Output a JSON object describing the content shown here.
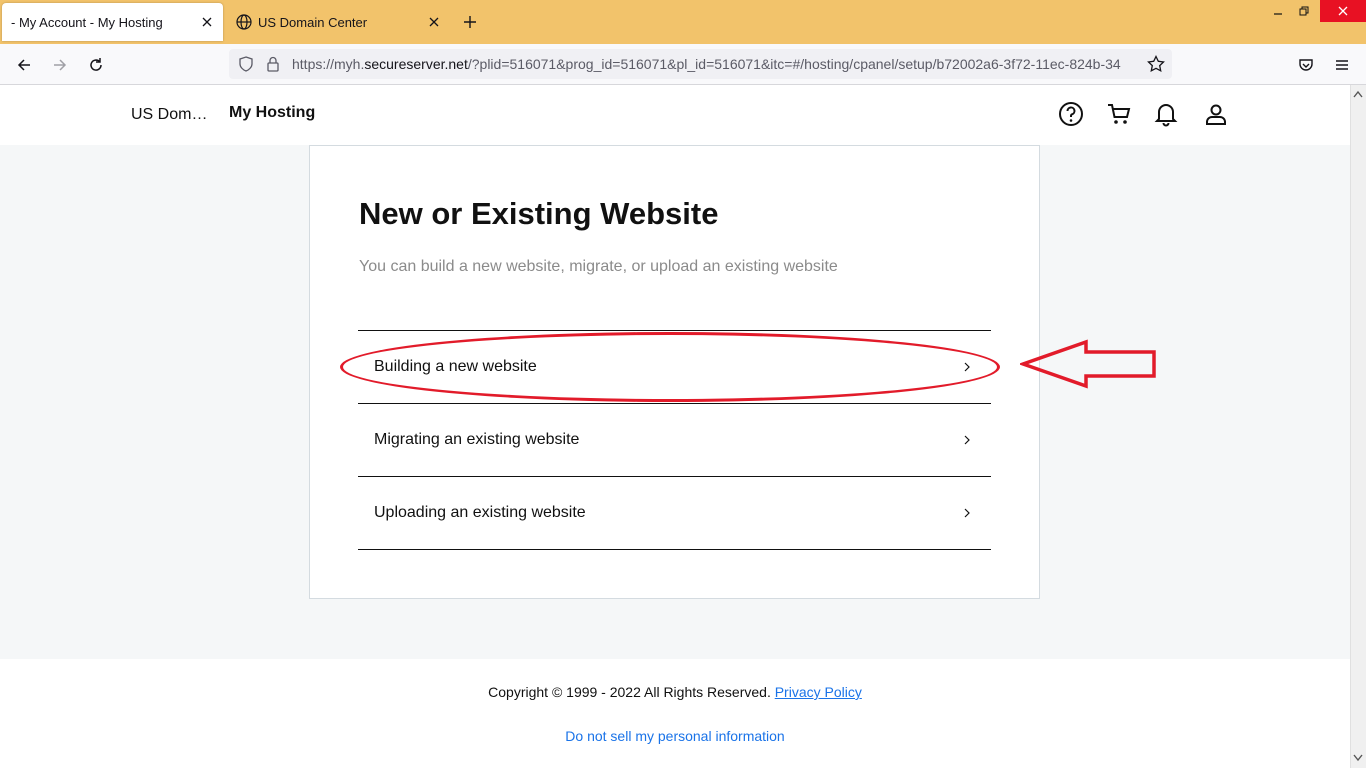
{
  "browser": {
    "tabs": [
      {
        "label": "- My Account - My Hosting",
        "active": true
      },
      {
        "label": "US Domain Center",
        "active": false
      }
    ],
    "url_prefix": "https://myh.",
    "url_domain": "secureserver.net",
    "url_rest": "/?plid=516071&prog_id=516071&pl_id=516071&itc=#/hosting/cpanel/setup/b72002a6-3f72-11ec-824b-34"
  },
  "header": {
    "brand": "US Domain Center",
    "nav_label": "My Hosting"
  },
  "card": {
    "title": "New or Existing Website",
    "subtitle": "You can build a new website, migrate, or upload an existing website",
    "options": [
      {
        "label": "Building a new website"
      },
      {
        "label": "Migrating an existing website"
      },
      {
        "label": "Uploading an existing website"
      }
    ]
  },
  "footer": {
    "copyright": "Copyright © 1999 - 2022 All Rights Reserved.",
    "privacy_link": "Privacy Policy",
    "do_not_sell": "Do not sell my personal information"
  },
  "colors": {
    "tabbar": "#f2c36b",
    "annotation": "#e21b2a",
    "link": "#1a73e8"
  }
}
